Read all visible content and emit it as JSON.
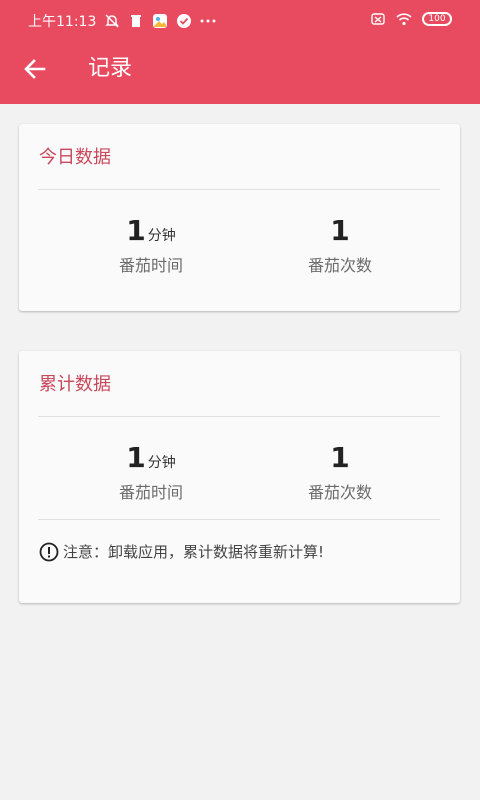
{
  "status_bar": {
    "time": "上午11:13",
    "battery": "100"
  },
  "header": {
    "title": "记录"
  },
  "today": {
    "title": "今日数据",
    "focus_time_value": "1",
    "focus_time_unit": "分钟",
    "focus_time_label": "番茄时间",
    "count_value": "1",
    "count_label": "番茄次数"
  },
  "total": {
    "title": "累计数据",
    "focus_time_value": "1",
    "focus_time_unit": "分钟",
    "focus_time_label": "番茄时间",
    "count_value": "1",
    "count_label": "番茄次数",
    "note": "注意：卸载应用，累计数据将重新计算!"
  },
  "colors": {
    "accent": "#e84a5f",
    "card_title": "#c9485b"
  }
}
